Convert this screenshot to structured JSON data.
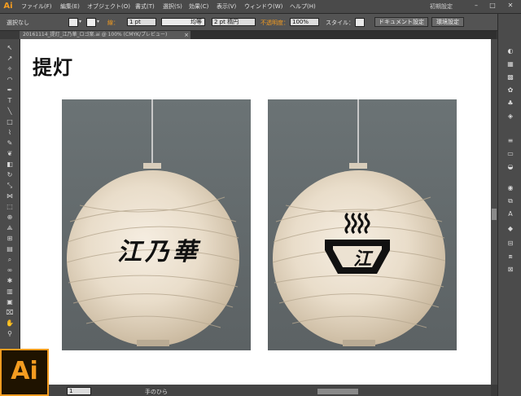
{
  "app": {
    "logo": "Ai",
    "menus": [
      "ファイル(F)",
      "編集(E)",
      "オブジェクト(O)",
      "書式(T)",
      "選択(S)",
      "効果(C)",
      "表示(V)",
      "ウィンドウ(W)",
      "ヘルプ(H)"
    ],
    "workspace": "初期設定",
    "window_buttons": [
      "–",
      "□",
      "✕"
    ]
  },
  "control": {
    "selection_label": "選択なし",
    "stroke_label": "線：",
    "stroke_weight": "1 pt",
    "profile_label": "均等",
    "brush_label": "2 pt 楕円",
    "opacity_label": "不透明度：",
    "opacity_value": "100%",
    "style_label": "スタイル：",
    "doc_settings_btn": "ドキュメント設定",
    "env_settings_btn": "環境設定"
  },
  "document": {
    "tab_title": "20161114_提灯_江乃華_ロゴ案.ai @ 100% (CMYK/プレビュー)",
    "heading": "提灯",
    "lanterns": [
      {
        "text": "江乃華"
      },
      {
        "text": "江"
      }
    ]
  },
  "status": {
    "zoom": "1",
    "tool_label": "手のひら"
  },
  "colors": {
    "brand": "#f49c20",
    "ui_dark": "#3a3a3a",
    "canvas": "#ffffff"
  },
  "icons": {
    "tools": [
      "selection-tool-icon",
      "direct-selection-tool-icon",
      "magic-wand-icon",
      "lasso-icon",
      "pen-icon",
      "type-icon",
      "line-icon",
      "rectangle-icon",
      "paintbrush-icon",
      "pencil-icon",
      "blob-brush-icon",
      "eraser-icon",
      "rotate-icon",
      "scale-icon",
      "width-icon",
      "free-transform-icon",
      "shape-builder-icon",
      "perspective-icon",
      "mesh-icon",
      "gradient-icon",
      "eyedropper-icon",
      "blend-icon",
      "symbol-sprayer-icon",
      "graph-icon",
      "artboard-icon",
      "slice-icon",
      "hand-icon",
      "zoom-icon"
    ],
    "panels": [
      "color-panel-icon",
      "color-guide-icon",
      "swatches-icon",
      "brushes-icon",
      "symbols-icon",
      "graphic-styles-icon",
      "stroke-icon",
      "gradient-panel-icon",
      "transparency-icon",
      "appearance-icon",
      "layers-icon",
      "links-icon",
      "align-icon",
      "pathfinder-icon",
      "transform-icon",
      "character-icon"
    ]
  }
}
